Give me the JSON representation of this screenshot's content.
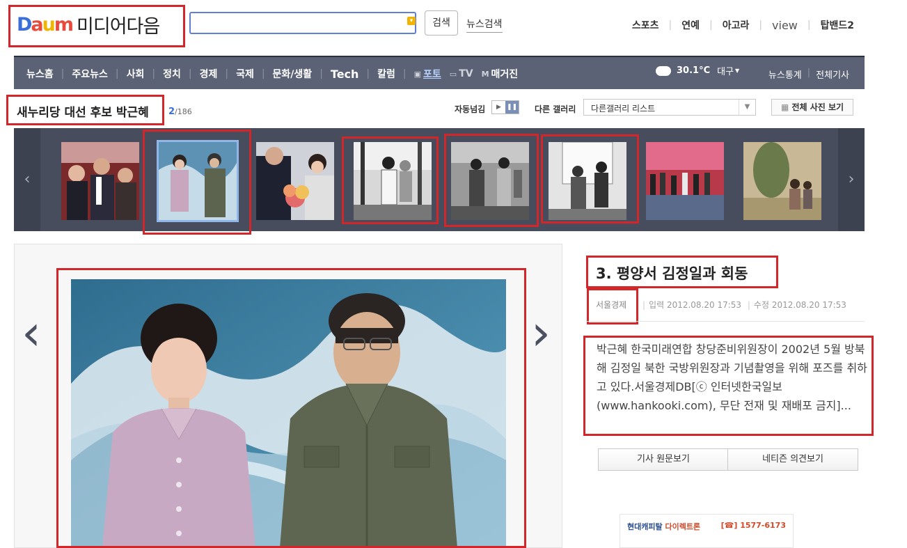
{
  "header": {
    "logo_text": "Daum",
    "site_title": "미디어다음",
    "search_placeholder": "",
    "search_button": "검색",
    "news_search": "뉴스검색",
    "top_links": [
      "스포츠",
      "연예",
      "아고라",
      "view",
      "탑밴드2"
    ]
  },
  "nav": {
    "items": [
      "뉴스홈",
      "주요뉴스",
      "사회",
      "정치",
      "경제",
      "국제",
      "문화/생활",
      "Tech",
      "칼럼"
    ],
    "photo": "포토",
    "tv": "TV",
    "magazine": "매거진",
    "weather_temp": "30.1°C",
    "weather_city": "대구",
    "right_links": [
      "뉴스통계",
      "전체기사"
    ]
  },
  "gallery": {
    "title": "새누리당 대선 후보 박근혜",
    "current": "2",
    "total": "/186",
    "auto_next_label": "자동넘김",
    "other_gallery_label": "다른 갤러리",
    "other_gallery_value": "다른갤러리 리스트",
    "all_photos_button": "전체 사진 보기",
    "selected_index": 2
  },
  "article": {
    "title": "3. 평양서 김정일과 회동",
    "source": "서울경제",
    "input_time": "입력 2012.08.20 17:53",
    "edit_time": "수정 2012.08.20 17:53",
    "body": "박근혜 한국미래연합 창당준비위원장이 2002년 5월 방북해 김정일 북한 국방위원장과 기념촬영을 위해 포즈를 취하고 있다.서울경제DB[ⓒ 인터넷한국일보(www.hankooki.com), 무단 전재 및 재배포 금지]...",
    "btn_original": "기사 원문보기",
    "btn_opinion": "네티즌 의견보기"
  },
  "ad": {
    "brand": "현대캐피탈",
    "brand2": "다이렉트론",
    "phone": "[☎] 1577-6173"
  },
  "colors": {
    "highlight": "#d3262b",
    "nav_bg": "#5b6275",
    "strip_bg": "#474d5c",
    "accent_blue": "#3a6fd8"
  }
}
